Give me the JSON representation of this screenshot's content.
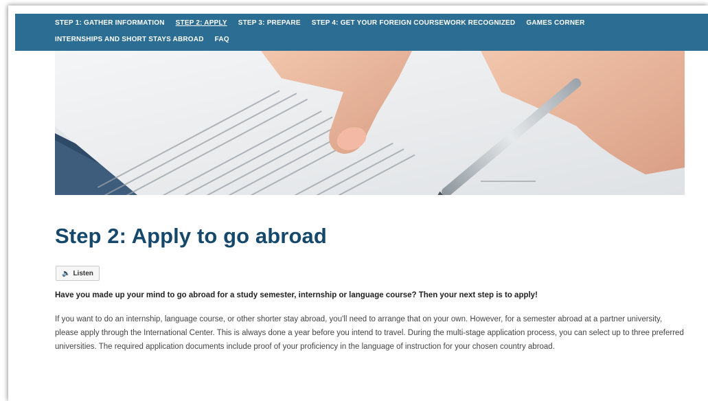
{
  "nav": {
    "row1": [
      {
        "label": "STEP 1: GATHER INFORMATION",
        "active": false
      },
      {
        "label": "STEP 2: APPLY",
        "active": true
      },
      {
        "label": "STEP 3: PREPARE",
        "active": false
      },
      {
        "label": "STEP 4: GET YOUR FOREIGN COURSEWORK RECOGNIZED",
        "active": false
      },
      {
        "label": "GAMES CORNER",
        "active": false
      }
    ],
    "row2": [
      {
        "label": "INTERNSHIPS AND SHORT STAYS ABROAD",
        "active": false
      },
      {
        "label": "FAQ",
        "active": false
      }
    ],
    "background": "#2c6d93"
  },
  "hero": {
    "icon": "contract-signing-photo"
  },
  "page": {
    "title": "Step 2: Apply to go abroad",
    "listen_label": "Listen",
    "listen_icon": "speaker-icon",
    "lead": "Have you made up your mind to go abroad for a study semester, internship or language course? Then your next step is to apply!",
    "body": "If you want to do an internship, language course, or other shorter stay abroad, you'll need to arrange that on your own. However, for a semester abroad at a partner university, please apply through the International Center. This is always done a year before you intend to travel. During the multi-stage application process, you can select up to three preferred universities. The required application documents include proof of your proficiency in the language of instruction for your chosen country abroad."
  },
  "colors": {
    "title": "#15486b",
    "accent": "#2c6d93"
  }
}
